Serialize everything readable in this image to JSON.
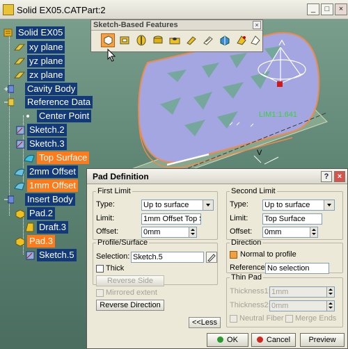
{
  "window": {
    "title": "Solid EX05.CATPart:2"
  },
  "tree": {
    "root": "Solid EX05",
    "items": [
      {
        "label": "xy plane"
      },
      {
        "label": "yz plane"
      },
      {
        "label": "zx plane"
      },
      {
        "label": "Cavity Body"
      },
      {
        "label": "Reference Data"
      },
      {
        "label": "Center Point"
      },
      {
        "label": "Sketch.2"
      },
      {
        "label": "Sketch.3"
      },
      {
        "label": "Top Surface"
      },
      {
        "label": "2mm Offset"
      },
      {
        "label": "1mm Offset"
      },
      {
        "label": "Insert Body"
      },
      {
        "label": "Pad.2"
      },
      {
        "label": "Draft.3"
      },
      {
        "label": "Pad.3"
      },
      {
        "label": "Sketch.5"
      }
    ]
  },
  "viewport": {
    "dimension_label": "LIM1:1.641",
    "axis_label": "V"
  },
  "toolbar": {
    "title": "Sketch-Based Features"
  },
  "dialog": {
    "title": "Pad Definition",
    "first_limit": {
      "legend": "First Limit",
      "type_label": "Type:",
      "type_value": "Up to surface",
      "limit_label": "Limit:",
      "limit_value": "1mm Offset Top S",
      "offset_label": "Offset:",
      "offset_value": "0mm"
    },
    "second_limit": {
      "legend": "Second Limit",
      "type_label": "Type:",
      "type_value": "Up to surface",
      "limit_label": "Limit:",
      "limit_value": "Top Surface",
      "offset_label": "Offset:",
      "offset_value": "0mm"
    },
    "profile": {
      "legend": "Profile/Surface",
      "selection_label": "Selection:",
      "selection_value": "Sketch.5",
      "thick_label": "Thick",
      "reverse_side_label": "Reverse Side"
    },
    "mirrored_label": "Mirrored extent",
    "reverse_direction_label": "Reverse Direction",
    "less_label": "<<Less",
    "direction": {
      "legend": "Direction",
      "normal_label": "Normal to profile",
      "reference_label": "Reference:",
      "reference_value": "No selection"
    },
    "thin_pad": {
      "legend": "Thin Pad",
      "thickness1_label": "Thickness1:",
      "thickness1_value": "1mm",
      "thickness2_label": "Thickness2:",
      "thickness2_value": "0mm",
      "neutral_label": "Neutral Fiber",
      "merge_label": "Merge Ends"
    },
    "ok_label": "OK",
    "cancel_label": "Cancel",
    "preview_label": "Preview"
  }
}
